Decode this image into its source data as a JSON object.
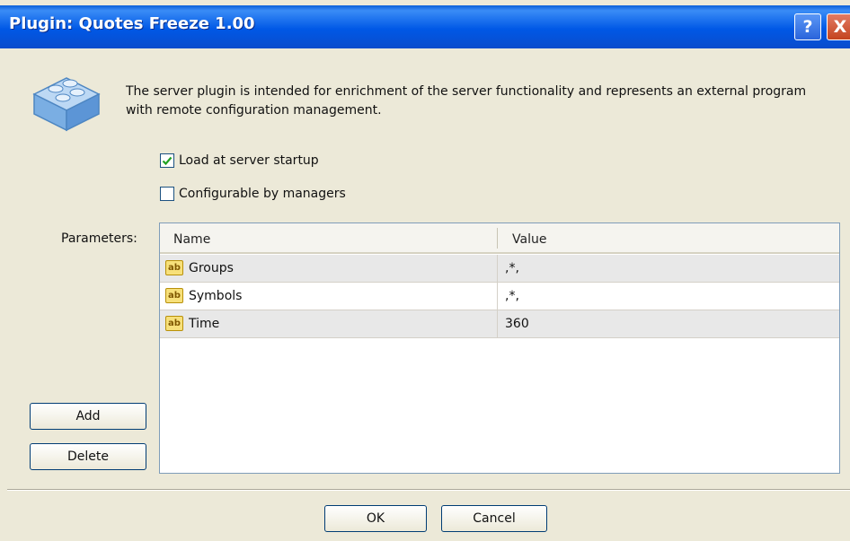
{
  "window": {
    "title": "Plugin: Quotes Freeze 1.00"
  },
  "titlebar_buttons": {
    "help": "?",
    "close": "X"
  },
  "description": "The server plugin is intended for enrichment of the server functionality and represents an external program with remote configuration management.",
  "options": [
    {
      "label": "Load at server startup",
      "checked": true
    },
    {
      "label": "Configurable by managers",
      "checked": false
    }
  ],
  "parameters": {
    "label": "Parameters:",
    "columns": [
      "Name",
      "Value"
    ],
    "rows": [
      {
        "name": "Groups",
        "value": ",*,",
        "icon": "ab-string-icon"
      },
      {
        "name": "Symbols",
        "value": ",*,",
        "icon": "ab-string-icon"
      },
      {
        "name": "Time",
        "value": "360",
        "icon": "ab-string-icon"
      }
    ],
    "row_icon_text": "ab"
  },
  "buttons": {
    "add": "Add",
    "delete": "Delete",
    "ok": "OK",
    "cancel": "Cancel"
  },
  "colors": {
    "titlebar": "#0058e6",
    "dialog_bg": "#ece9d8",
    "checkmark": "#21a121"
  }
}
